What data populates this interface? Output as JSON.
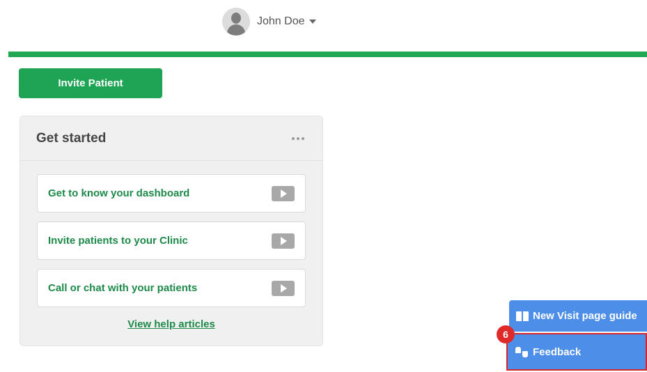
{
  "header": {
    "user_name": "John Doe"
  },
  "actions": {
    "invite_label": "Invite Patient"
  },
  "get_started": {
    "title": "Get started",
    "items": [
      {
        "label": "Get to know your dashboard"
      },
      {
        "label": "Invite patients to your Clinic"
      },
      {
        "label": "Call or chat with your patients"
      }
    ],
    "help_link": "View help articles"
  },
  "floating": {
    "guide_label": "New Visit page guide",
    "feedback_label": "Feedback",
    "badge": "6"
  },
  "colors": {
    "brand_green": "#1fa455",
    "link_green": "#1e8a4a",
    "float_blue": "#4d8ee8",
    "highlight_red": "#d7262b"
  }
}
